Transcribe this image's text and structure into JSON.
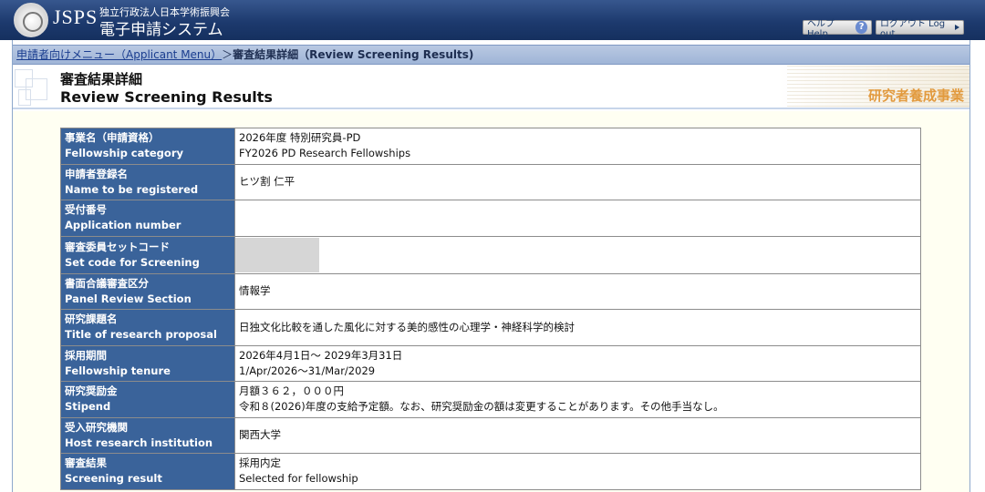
{
  "header": {
    "brand": "JSPS",
    "org_name": "独立行政法人日本学術振興会",
    "system_name": "電子申請システム",
    "help_label": "ヘルプ Help",
    "logout_label": "ログアウト Log out"
  },
  "breadcrumb": {
    "menu_link": "申請者向けメニュー（Applicant Menu）",
    "separator": "＞",
    "current": "審査結果詳細（Review Screening Results)"
  },
  "page": {
    "title_ja": "審査結果詳細",
    "title_en": "Review Screening Results",
    "program": "研究者養成事業"
  },
  "rows": [
    {
      "label_ja": "事業名（申請資格）",
      "label_en": "Fellowship category",
      "value_1": "2026年度 特別研究員-PD",
      "value_2": "FY2026 PD Research Fellowships"
    },
    {
      "label_ja": "申請者登録名",
      "label_en": "Name to be registered",
      "value_1": "ヒツ割 仁平",
      "value_2": ""
    },
    {
      "label_ja": "受付番号",
      "label_en": "Application number",
      "value_1": "",
      "value_2": ""
    },
    {
      "label_ja": "審査委員セットコード",
      "label_en": "Set code for Screening",
      "value_1": "",
      "value_2": ""
    },
    {
      "label_ja": "書面合議審査区分",
      "label_en": "Panel Review Section",
      "value_1": "情報学",
      "value_2": ""
    },
    {
      "label_ja": "研究課題名",
      "label_en": "Title of research proposal",
      "value_1": "日独文化比較を通した風化に対する美的感性の心理学・神経科学的検討",
      "value_2": ""
    },
    {
      "label_ja": "採用期間",
      "label_en": "Fellowship tenure",
      "value_1": "2026年4月1日～ 2029年3月31日",
      "value_2": "1/Apr/2026～31/Mar/2029"
    },
    {
      "label_ja": "研究奨励金",
      "label_en": "Stipend",
      "value_1": "月額３６２，０００円",
      "value_2": "令和８(2026)年度の支給予定額。なお、研究奨励金の額は変更することがあります。その他手当なし。"
    },
    {
      "label_ja": "受入研究機関",
      "label_en": "Host research institution",
      "value_1": "関西大学",
      "value_2": ""
    },
    {
      "label_ja": "審査結果",
      "label_en": "Screening result",
      "value_1": "採用内定",
      "value_2": "Selected for fellowship"
    }
  ]
}
